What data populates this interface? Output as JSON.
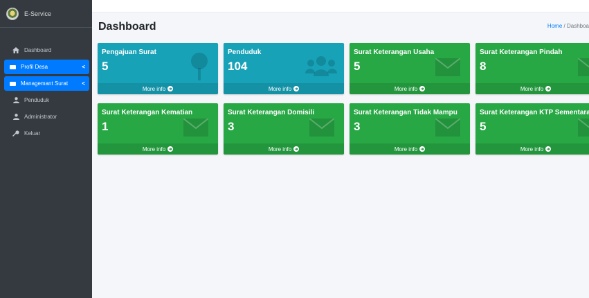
{
  "sidebar": {
    "brand": "E-Service",
    "items": [
      {
        "label": "Dashboard",
        "icon": "home-icon"
      },
      {
        "label": "Profil Desa",
        "icon": "envelope-icon",
        "caret": "<"
      },
      {
        "label": "Managemant Surat",
        "icon": "envelope-icon",
        "caret": "<"
      },
      {
        "label": "Penduduk",
        "icon": "user-icon"
      },
      {
        "label": "Administrator",
        "icon": "user-icon"
      },
      {
        "label": "Keluar",
        "icon": "key-icon"
      }
    ]
  },
  "header": {
    "title": "Dashboard",
    "breadcrumb_home": "Home",
    "breadcrumb_sep": "/",
    "breadcrumb_current": "Dashboa"
  },
  "boxes": [
    {
      "title": "Pengajuan Surat",
      "count": "5",
      "footer": "More info",
      "color": "#17a2b8",
      "icon": "map-pin-icon"
    },
    {
      "title": "Penduduk",
      "count": "104",
      "footer": "More info",
      "color": "#17a2b8",
      "icon": "users-icon"
    },
    {
      "title": "Surat Keterangan Usaha",
      "count": "5",
      "footer": "More info",
      "color": "#28a745",
      "icon": "envelope-icon"
    },
    {
      "title": "Surat Keterangan Pindah",
      "count": "8",
      "footer": "More info",
      "color": "#28a745",
      "icon": "envelope-icon"
    },
    {
      "title": "Surat Keterangan Kematian",
      "count": "1",
      "footer": "More info",
      "color": "#28a745",
      "icon": "envelope-icon"
    },
    {
      "title": "Surat Keterangan Domisili",
      "count": "3",
      "footer": "More info",
      "color": "#28a745",
      "icon": "envelope-icon"
    },
    {
      "title": "Surat Keterangan Tidak Mampu",
      "count": "3",
      "footer": "More info",
      "color": "#28a745",
      "icon": "envelope-icon"
    },
    {
      "title": "Surat Keterangan KTP Sementara",
      "count": "5",
      "footer": "More info",
      "color": "#28a745",
      "icon": "envelope-icon"
    }
  ],
  "colors": {
    "sidebar_bg": "#343a40",
    "active": "#007bff",
    "teal": "#17a2b8",
    "green": "#28a745"
  }
}
